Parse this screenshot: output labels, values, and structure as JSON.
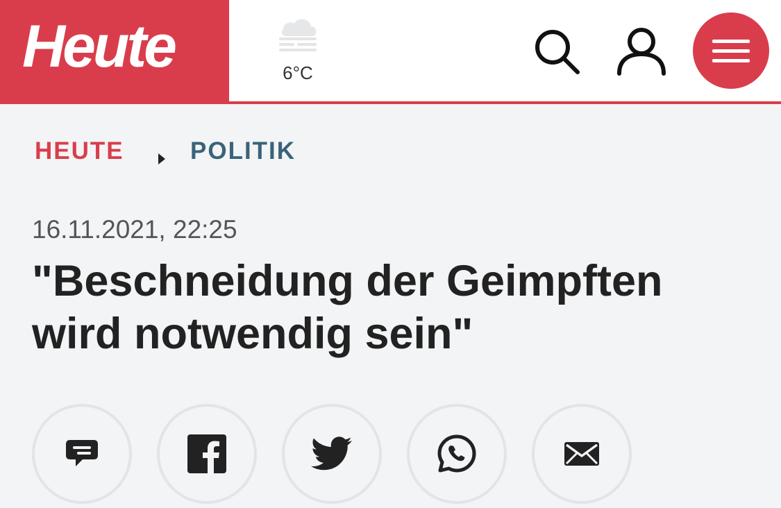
{
  "header": {
    "logo_text": "Heute",
    "brand_color": "#d93d4c",
    "weather": {
      "icon": "fog-cloud-icon",
      "temperature": "6°C"
    },
    "search_icon": "search-icon",
    "user_icon": "user-icon",
    "menu_icon": "hamburger-menu-icon"
  },
  "breadcrumb": {
    "home": "HEUTE",
    "separator_icon": "chevron-right-icon",
    "section": "POLITIK",
    "home_color": "#d93d4c",
    "section_color": "#3a6378"
  },
  "article": {
    "date": "16.11.2021, 22:25",
    "headline": "\"Beschneidung der Geimpften wird notwendig sein\""
  },
  "share": [
    {
      "icon": "comment-icon"
    },
    {
      "icon": "facebook-icon"
    },
    {
      "icon": "twitter-icon"
    },
    {
      "icon": "whatsapp-icon"
    },
    {
      "icon": "email-icon"
    }
  ]
}
